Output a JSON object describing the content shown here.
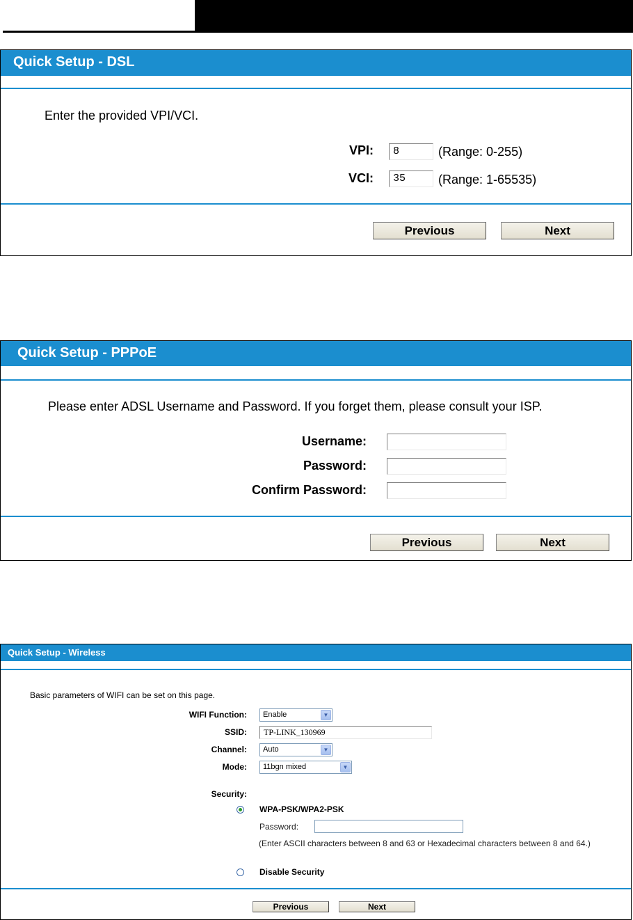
{
  "dsl": {
    "title": "Quick Setup - DSL",
    "instruction": "Enter the provided VPI/VCI.",
    "vpi": {
      "label": "VPI:",
      "value": "8",
      "range": "(Range: 0-255)"
    },
    "vci": {
      "label": "VCI:",
      "value": "35",
      "range": "(Range: 1-65535)"
    },
    "previous_label": "Previous",
    "next_label": "Next"
  },
  "pppoe": {
    "title": "Quick Setup - PPPoE",
    "instruction": "Please enter ADSL Username and Password. If you forget them, please consult your ISP.",
    "username_label": "Username:",
    "password_label": "Password:",
    "confirm_label": "Confirm Password:",
    "username_value": "",
    "password_value": "",
    "confirm_value": "",
    "previous_label": "Previous",
    "next_label": "Next"
  },
  "wireless": {
    "title": "Quick Setup - Wireless",
    "instruction": "Basic parameters of WIFI can be set on this page.",
    "wifi_function": {
      "label": "WIFI Function:",
      "value": "Enable"
    },
    "ssid": {
      "label": "SSID:",
      "value": "TP-LINK_130969"
    },
    "channel": {
      "label": "Channel:",
      "value": "Auto"
    },
    "mode": {
      "label": "Mode:",
      "value": "11bgn mixed"
    },
    "security_label": "Security:",
    "wpa_option": "WPA-PSK/WPA2-PSK",
    "password_label": "Password:",
    "password_value": "",
    "hint": "(Enter ASCII characters between 8 and 63 or Hexadecimal characters between 8 and 64.)",
    "disable_option": "Disable Security",
    "previous_label": "Previous",
    "next_label": "Next"
  },
  "colors": {
    "accent": "#1b8ecf",
    "header": "#000000"
  },
  "icons": {
    "dropdown": "chevron-down-icon",
    "radio_selected": "radio-selected-icon",
    "radio_unselected": "radio-unselected-icon"
  }
}
